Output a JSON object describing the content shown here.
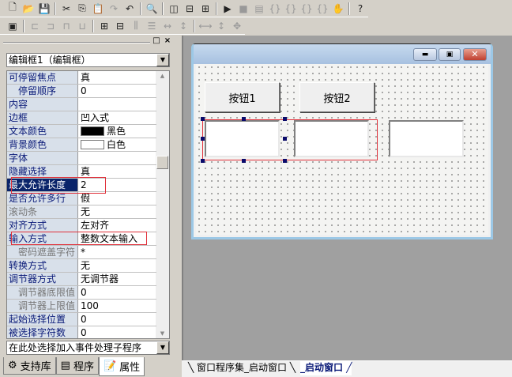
{
  "toolbar1": [
    "new-file-icon",
    "open-folder-icon",
    "save-icon",
    "|",
    "cut-icon",
    "copy-icon",
    "paste-icon",
    "redo-icon",
    "undo-icon",
    "|",
    "find-icon",
    "|",
    "layout1-icon",
    "layout2-icon",
    "layout3-icon",
    "|",
    "run-icon",
    "stop-icon",
    "debug-icon",
    "step-in-icon",
    "step-over-icon",
    "step-out-icon",
    "run-to-icon",
    "hand-icon",
    "|",
    "help-search-icon"
  ],
  "toolbar2": [
    "form-icon",
    "|",
    "align-left-icon",
    "align-right-icon",
    "align-top-icon",
    "align-bottom-icon",
    "|",
    "center-h-icon",
    "center-v-icon",
    "space-h-icon",
    "space-v-icon",
    "dist-h-icon",
    "dist-v-icon",
    "|",
    "same-width-icon",
    "same-height-icon",
    "same-size-icon"
  ],
  "panel": {
    "object_selector": "编辑框1（编辑框）",
    "event_selector": "在此处选择加入事件处理子程序",
    "properties": [
      {
        "name": "可停留焦点",
        "value": "真"
      },
      {
        "name": "停留顺序",
        "value": "0",
        "indent": true
      },
      {
        "name": "内容",
        "value": ""
      },
      {
        "name": "边框",
        "value": "凹入式"
      },
      {
        "name": "文本颜色",
        "value": "黑色",
        "swatch": "#000000"
      },
      {
        "name": "背景颜色",
        "value": "白色",
        "swatch": "#ffffff"
      },
      {
        "name": "字体",
        "value": ""
      },
      {
        "name": "隐藏选择",
        "value": "真"
      },
      {
        "name": "最大允许长度",
        "value": "2",
        "selected": true
      },
      {
        "name": "是否允许多行",
        "value": "假"
      },
      {
        "name": "滚动条",
        "value": "无",
        "gray": true
      },
      {
        "name": "对齐方式",
        "value": "左对齐"
      },
      {
        "name": "输入方式",
        "value": "整数文本输入"
      },
      {
        "name": "密码遮盖字符",
        "value": "*",
        "indent": true,
        "gray": true
      },
      {
        "name": "转换方式",
        "value": "无"
      },
      {
        "name": "调节器方式",
        "value": "无调节器"
      },
      {
        "name": "调节器底限值",
        "value": "0",
        "indent": true,
        "gray": true
      },
      {
        "name": "调节器上限值",
        "value": "100",
        "indent": true,
        "gray": true
      },
      {
        "name": "起始选择位置",
        "value": "0"
      },
      {
        "name": "被选择字符数",
        "value": "0"
      }
    ],
    "tabs": [
      {
        "label": "支持库"
      },
      {
        "label": "程序"
      },
      {
        "label": "属性",
        "active": true
      }
    ]
  },
  "designer": {
    "button1": "按钮1",
    "button2": "按钮2",
    "highlight_color": "#e0303a"
  },
  "bottom_tabs": [
    {
      "label": "窗口程序集_启动窗口"
    },
    {
      "label": "_启动窗口",
      "active": true
    }
  ]
}
